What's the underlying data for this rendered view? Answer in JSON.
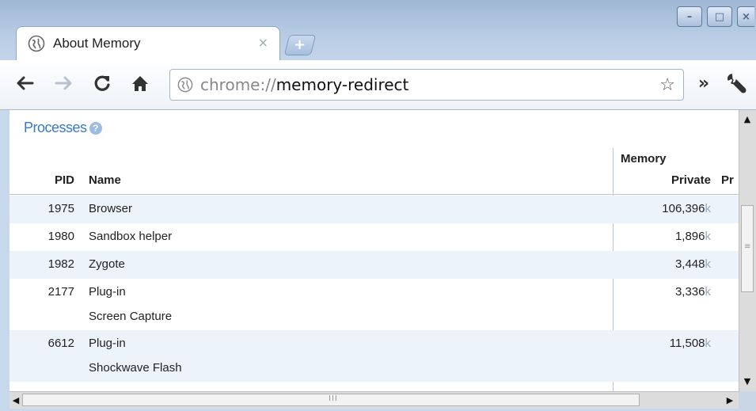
{
  "window": {
    "controls": [
      "–",
      "□",
      "×"
    ]
  },
  "tab": {
    "title": "About Memory",
    "close": "×",
    "new_tab": "+"
  },
  "toolbar": {
    "back": "←",
    "forward": "→",
    "reload": "C",
    "home": "⌂",
    "url_scheme": "chrome://",
    "url_host": "memory-redirect",
    "bookmark_star": "☆",
    "overflow": "»",
    "wrench": "wrench-icon"
  },
  "page": {
    "section_title": "Processes",
    "help": "?",
    "headers": {
      "pid": "PID",
      "name": "Name",
      "memory": "Memory",
      "private": "Private",
      "proportional": "Pr"
    },
    "rows": [
      {
        "pid": "1975",
        "name": "Browser",
        "sub": "",
        "private": "106,396",
        "unit": "k"
      },
      {
        "pid": "1980",
        "name": "Sandbox helper",
        "sub": "",
        "private": "1,896",
        "unit": "k"
      },
      {
        "pid": "1982",
        "name": "Zygote",
        "sub": "",
        "private": "3,448",
        "unit": "k"
      },
      {
        "pid": "2177",
        "name": "Plug-in",
        "sub": "Screen Capture",
        "private": "3,336",
        "unit": "k"
      },
      {
        "pid": "6612",
        "name": "Plug-in",
        "sub": "Shockwave Flash",
        "private": "11,508",
        "unit": "k"
      }
    ]
  },
  "scrollbars": {
    "grip_v": "≡",
    "grip_h": "III",
    "up": "▲",
    "down": "▼",
    "left": "◀",
    "right": "▶"
  }
}
